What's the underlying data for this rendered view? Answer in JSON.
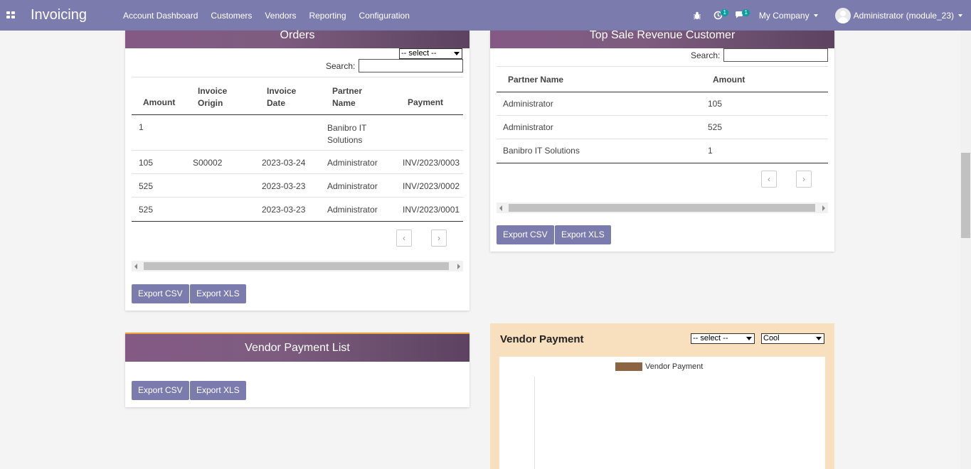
{
  "navbar": {
    "brand": "Invoicing",
    "menu": [
      "Account Dashboard",
      "Customers",
      "Vendors",
      "Reporting",
      "Configuration"
    ],
    "activity_badge": "1",
    "messages_badge": "1",
    "company": "My Company",
    "user": "Administrator (module_23)"
  },
  "orders": {
    "title": "Orders",
    "select_placeholder": "-- select --",
    "search_label": "Search:",
    "columns": [
      "Amount",
      "Invoice Origin",
      "Invoice Date",
      "Partner Name",
      "Payment"
    ],
    "rows": [
      [
        "1",
        "",
        "",
        "Banibro IT Solutions",
        ""
      ],
      [
        "105",
        "S00002",
        "2023-03-24",
        "Administrator",
        "INV/2023/0003"
      ],
      [
        "525",
        "",
        "2023-03-23",
        "Administrator",
        "INV/2023/0002"
      ],
      [
        "525",
        "",
        "2023-03-23",
        "Administrator",
        "INV/2023/0001"
      ]
    ],
    "prev": "‹",
    "next": "›",
    "export_csv": "Export CSV",
    "export_xls": "Export XLS"
  },
  "top_customer": {
    "title": "Top Sale Revenue Customer",
    "search_label": "Search:",
    "columns": [
      "Partner Name",
      "Amount"
    ],
    "rows": [
      [
        "Administrator",
        "105"
      ],
      [
        "Administrator",
        "525"
      ],
      [
        "Banibro IT Solutions",
        "1"
      ]
    ],
    "prev": "‹",
    "next": "›",
    "export_csv": "Export CSV",
    "export_xls": "Export XLS"
  },
  "vendor_payment_list": {
    "title": "Vendor Payment List",
    "export_csv": "Export CSV",
    "export_xls": "Export XLS"
  },
  "vendor_payment": {
    "title": "Vendor Payment",
    "select_placeholder": "-- select --",
    "theme_select": "Cool",
    "legend_color": "#8b6542",
    "background": "#f8dfbe"
  },
  "chart_data": {
    "type": "bar",
    "series": [
      {
        "name": "Vendor Payment",
        "values": []
      }
    ],
    "categories": []
  }
}
